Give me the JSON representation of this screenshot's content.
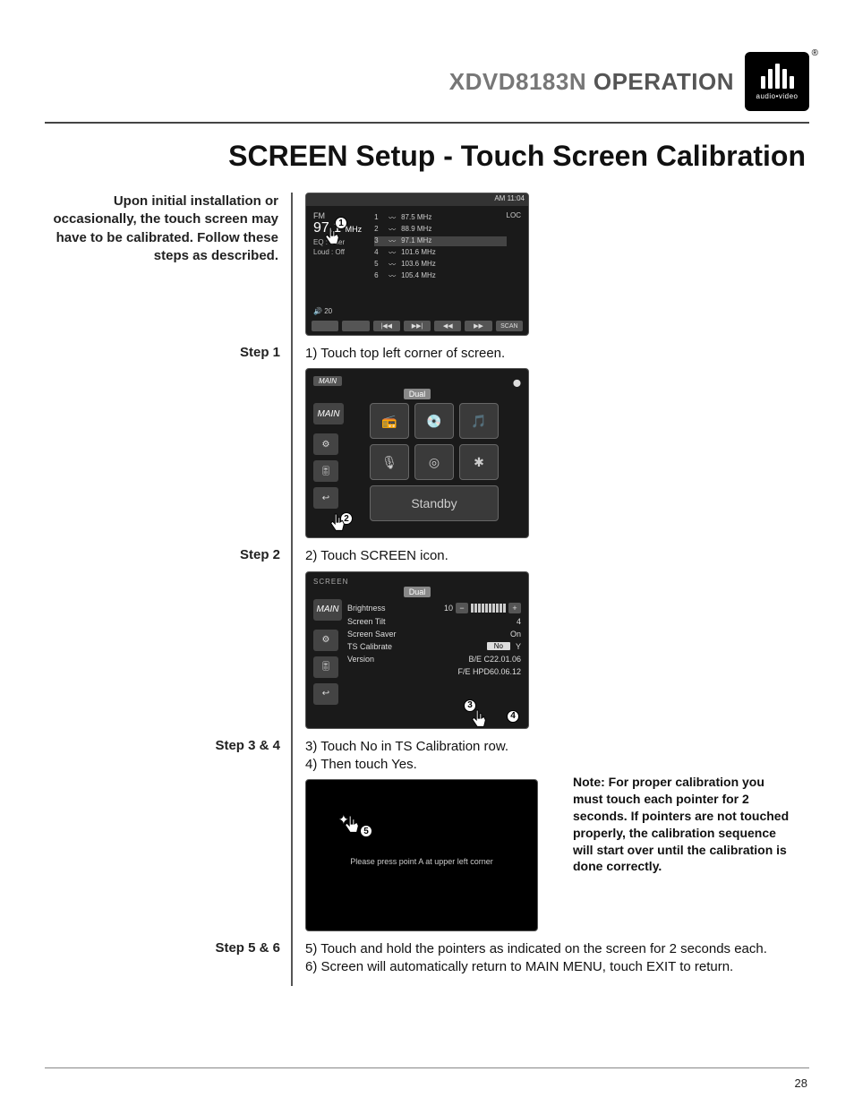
{
  "header": {
    "model": "XDVD8183N",
    "section": "OPERATION"
  },
  "logo": {
    "sub": "audio•video",
    "reg": "®"
  },
  "title": "SCREEN Setup - Touch Screen Calibration",
  "intro": "Upon initial installation or occasionally, the touch screen may have to be calibrated. Follow these steps as described.",
  "steps": {
    "s1": {
      "label": "Step 1",
      "text": "1) Touch top left corner of screen."
    },
    "s2": {
      "label": "Step 2",
      "text": "2) Touch SCREEN icon."
    },
    "s34": {
      "label": "Step 3 & 4",
      "text3": "3) Touch No in TS Calibration row.",
      "text4": "4) Then touch Yes."
    },
    "s56": {
      "label": "Step 5 & 6",
      "text5": "5) Touch and hold the pointers as indicated on the screen for 2 seconds each.",
      "text6": "6) Screen will automatically return to MAIN MENU, touch EXIT to return."
    }
  },
  "shot1": {
    "clock": "AM 11:04",
    "band": "FM",
    "freq": "97.1",
    "unit": "MHz",
    "loc": "LOC",
    "presets": [
      {
        "n": "1",
        "f": "87.5 MHz"
      },
      {
        "n": "2",
        "f": "88.9 MHz"
      },
      {
        "n": "3",
        "f": "97.1 MHz"
      },
      {
        "n": "4",
        "f": "101.6 MHz"
      },
      {
        "n": "5",
        "f": "103.6 MHz"
      },
      {
        "n": "6",
        "f": "105.4 MHz"
      }
    ],
    "eq": "EQ   : User",
    "loud": "Loud : Off",
    "vol": "20",
    "btns": [
      "",
      "",
      "|◀◀",
      "▶▶|",
      "◀◀",
      "▶▶",
      "SCAN"
    ],
    "marker": "1"
  },
  "shot2": {
    "topLabel": "MAIN",
    "brand": "Dual",
    "sideMain": "MAIN",
    "standby": "Standby",
    "marker": "2"
  },
  "shot3": {
    "topLabel": "SCREEN",
    "brand": "Dual",
    "sideMain": "MAIN",
    "rows": {
      "brightness": {
        "label": "Brightness",
        "value": "10"
      },
      "tilt": {
        "label": "Screen Tilt",
        "value": "4"
      },
      "saver": {
        "label": "Screen Saver",
        "value": "On"
      },
      "ts": {
        "label": "TS Calibrate",
        "no": "No",
        "yes": "Y"
      },
      "version": {
        "label": "Version",
        "be": "B/E  C22.01.06",
        "fe": "F/E  HPD60.06.12"
      }
    },
    "marker3": "3",
    "marker4": "4"
  },
  "shot4": {
    "prompt": "Please press point A at upper left corner",
    "marker": "5"
  },
  "note": "Note: For proper calibration you must touch each pointer for 2 seconds. If pointers are not touched properly, the calibration sequence will start over until the calibration is done correctly.",
  "pageNumber": "28"
}
